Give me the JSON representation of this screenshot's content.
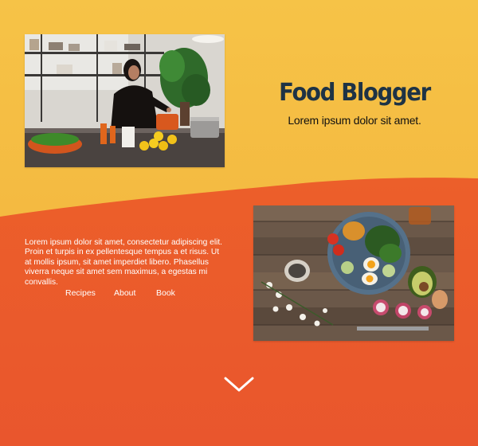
{
  "hero": {
    "title": "Food Blogger",
    "tagline": "Lorem ipsum dolor sit amet."
  },
  "intro": {
    "text": "Lorem ipsum dolor sit amet, consectetur adipiscing elit. Proin et turpis in ex pellentesque tempus a et risus. Ut at mollis ipsum, sit amet imperdiet libero. Phasellus viverra neque sit amet sem maximus, a egestas mi convallis."
  },
  "nav": {
    "items": [
      {
        "label": "Recipes"
      },
      {
        "label": "About"
      },
      {
        "label": "Book"
      }
    ]
  },
  "images": {
    "kitchen": "kitchen-cooking-photo",
    "salad": "salad-bowl-photo"
  },
  "icons": {
    "scroll": "chevron-down-icon"
  },
  "colors": {
    "top_background": "#f3b73f",
    "bottom_background": "#ea5a2b",
    "title": "#1e3345",
    "text_light": "#ffffff"
  }
}
